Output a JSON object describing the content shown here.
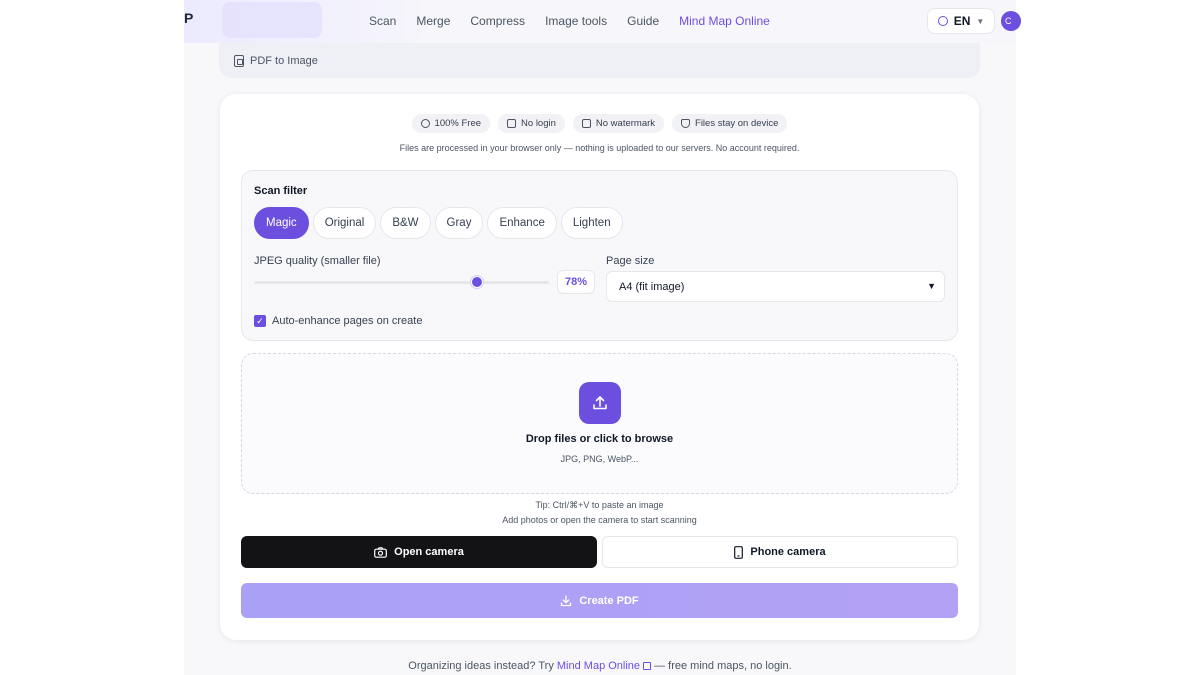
{
  "nav": {
    "logo_fragment": "P",
    "links": [
      "Scan",
      "Merge",
      "Compress",
      "Image tools",
      "Guide",
      "Mind Map Online"
    ],
    "active_link": "Mind Map Online",
    "lang": "EN",
    "avatar_fragment": "C"
  },
  "breadcrumb": {
    "label": "PDF to Image"
  },
  "badges": [
    "100% Free",
    "No login",
    "No watermark",
    "Files stay on device"
  ],
  "privacy_note": "Files are processed in your browser only — nothing is uploaded to our servers. No account required.",
  "scan_filter": {
    "title": "Scan filter",
    "options": [
      "Magic",
      "Original",
      "B&W",
      "Gray",
      "Enhance",
      "Lighten"
    ],
    "selected": "Magic"
  },
  "jpeg": {
    "label": "JPEG quality (smaller file)",
    "value": 78,
    "value_label": "78%"
  },
  "page_size": {
    "label": "Page size",
    "value": "A4 (fit image)"
  },
  "auto_enhance": {
    "label": "Auto-enhance pages on create",
    "checked": true
  },
  "dropzone": {
    "title": "Drop files or click to browse",
    "formats": "JPG, PNG, WebP..."
  },
  "tips": {
    "paste": "Tip: Ctrl/⌘+V to paste an image",
    "hint": "Add photos or open the camera to start scanning"
  },
  "buttons": {
    "open_camera": "Open camera",
    "phone_camera": "Phone camera",
    "create_pdf": "Create PDF"
  },
  "footer": {
    "prefix": "Organizing ideas instead? Try",
    "link": "Mind Map Online",
    "suffix": "— free mind maps, no login."
  },
  "colors": {
    "accent": "#6d4fe0",
    "dark_button": "#131316",
    "create_gradient_start": "#a9a1f5"
  }
}
